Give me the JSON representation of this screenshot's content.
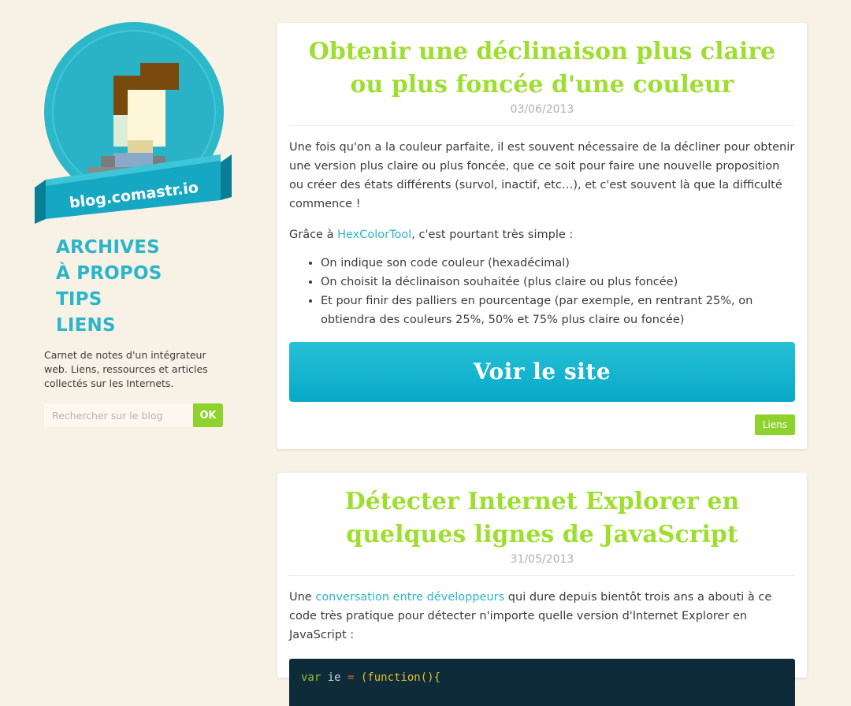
{
  "logo": {
    "banner_text": "blog.comastr.io"
  },
  "nav": {
    "items": [
      {
        "label": "ARCHIVES"
      },
      {
        "label": "À PROPOS"
      },
      {
        "label": "TIPS"
      },
      {
        "label": "LIENS"
      }
    ]
  },
  "sidebar": {
    "tagline": "Carnet de notes d'un intégrateur web. Liens, ressources et articles collectés sur les Internets.",
    "search": {
      "placeholder": "Rechercher sur le blog",
      "button_label": "OK"
    }
  },
  "posts": [
    {
      "title": "Obtenir une déclinaison plus claire ou plus foncée d'une couleur",
      "date": "03/06/2013",
      "intro": "Une fois qu'on a la couleur parfaite, il est souvent nécessaire de la décliner pour obtenir une version plus claire ou plus foncée, que ce soit pour faire une nouvelle proposition ou créer des états différents (survol, inactif, etc…), et c'est souvent là que la difficulté commence !",
      "p2_before": "Grâce à ",
      "p2_link": "HexColorTool",
      "p2_after": ", c'est pourtant très simple :",
      "list": [
        "On indique son code couleur (hexadécimal)",
        "On choisit la déclinaison souhaitée (plus claire ou plus foncée)",
        "Et pour finir des palliers en pourcentage (par exemple, en rentrant 25%, on obtiendra des couleurs 25%, 50% et 75% plus claire ou foncée)"
      ],
      "cta_label": "Voir le site",
      "tag": "Liens"
    },
    {
      "title": "Détecter Internet Explorer en quelques lignes de JavaScript",
      "date": "31/05/2013",
      "p_before": "Une ",
      "p_link": "conversation entre développeurs",
      "p_after": " qui dure depuis bientôt trois ans a abouti à ce code très pratique pour détecter n'importe quelle version d'Internet Explorer en JavaScript :",
      "code": {
        "kw": "var",
        "ident": " ie ",
        "op": "=",
        "fn": " (function(){"
      }
    }
  ],
  "colors": {
    "background": "#f8f1e6",
    "accent_green": "#9dde2e",
    "accent_blue": "#2bb5c8",
    "button_green": "#8ed22c",
    "code_bg": "#0e2b3a"
  }
}
